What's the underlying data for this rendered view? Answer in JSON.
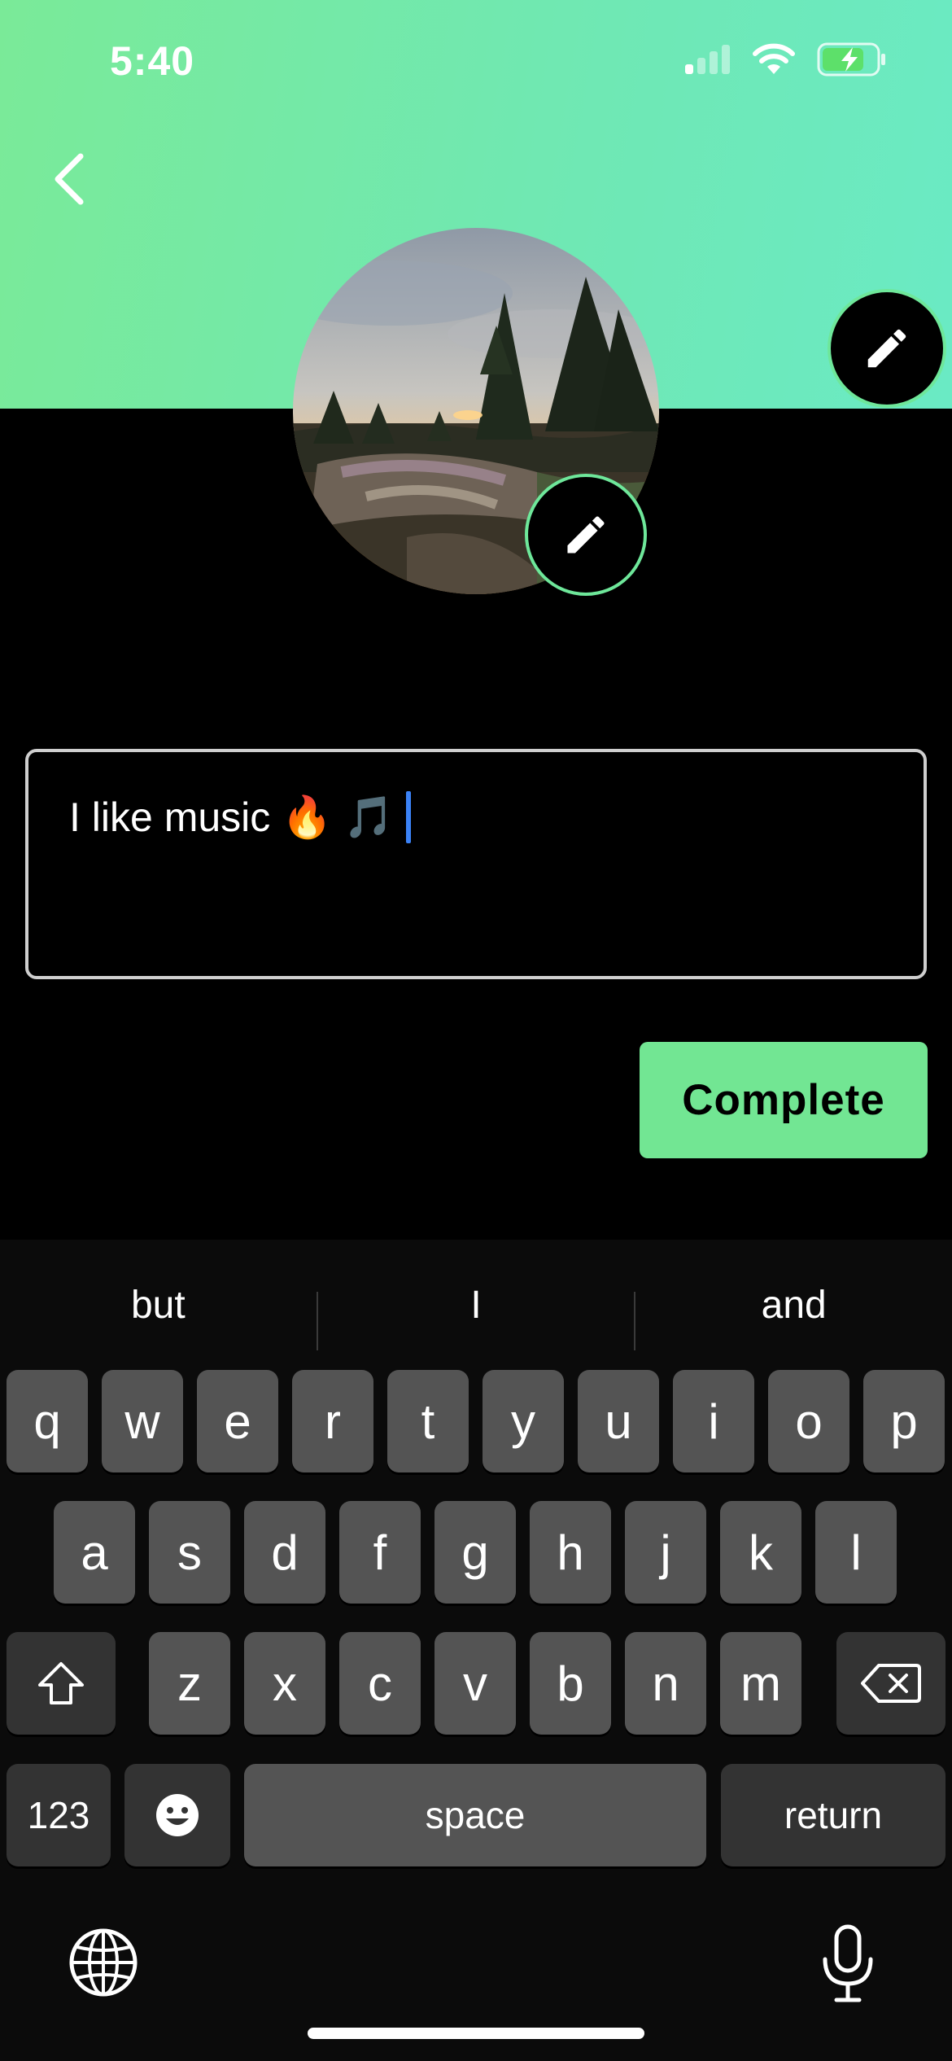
{
  "status_bar": {
    "time": "5:40"
  },
  "profile": {
    "bio_value": "I like music 🔥 🎵",
    "complete_label": "Complete"
  },
  "keyboard": {
    "suggestions": [
      "but",
      "I",
      "and"
    ],
    "row1": [
      "q",
      "w",
      "e",
      "r",
      "t",
      "y",
      "u",
      "i",
      "o",
      "p"
    ],
    "row2": [
      "a",
      "s",
      "d",
      "f",
      "g",
      "h",
      "j",
      "k",
      "l"
    ],
    "row3": [
      "z",
      "x",
      "c",
      "v",
      "b",
      "n",
      "m"
    ],
    "numbers_label": "123",
    "space_label": "space",
    "return_label": "return"
  },
  "icons": {
    "back": "chevron-left-icon",
    "edit": "pencil-icon",
    "globe": "globe-icon",
    "mic": "microphone-icon",
    "shift": "shift-icon",
    "delete": "backspace-icon",
    "emoji": "emoji-icon"
  },
  "colors": {
    "accent": "#72e693",
    "caret": "#3b82f6"
  }
}
